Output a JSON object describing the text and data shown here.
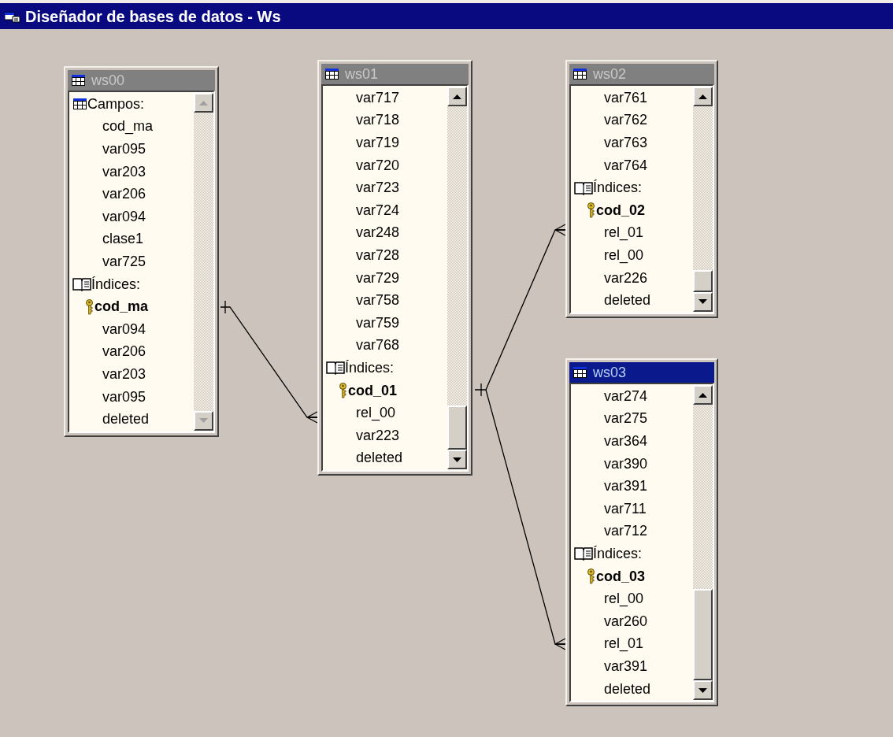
{
  "window": {
    "title": "Diseñador de bases de datos - Ws"
  },
  "tables": [
    {
      "name": "ws00",
      "active": false,
      "scrollbar_disabled": true,
      "items": [
        {
          "kind": "section",
          "text": "Campos:"
        },
        {
          "kind": "field",
          "text": "cod_ma"
        },
        {
          "kind": "field",
          "text": "var095"
        },
        {
          "kind": "field",
          "text": "var203"
        },
        {
          "kind": "field",
          "text": "var206"
        },
        {
          "kind": "field",
          "text": "var094"
        },
        {
          "kind": "field",
          "text": "clase1"
        },
        {
          "kind": "field",
          "text": "var725"
        },
        {
          "kind": "index_section",
          "text": "Índices:"
        },
        {
          "kind": "key",
          "text": "cod_ma"
        },
        {
          "kind": "field",
          "text": "var094"
        },
        {
          "kind": "field",
          "text": "var206"
        },
        {
          "kind": "field",
          "text": "var203"
        },
        {
          "kind": "field",
          "text": "var095"
        },
        {
          "kind": "field",
          "text": "deleted"
        }
      ]
    },
    {
      "name": "ws01",
      "active": false,
      "scrollbar_disabled": false,
      "items": [
        {
          "kind": "field",
          "text": "var717"
        },
        {
          "kind": "field",
          "text": "var718"
        },
        {
          "kind": "field",
          "text": "var719"
        },
        {
          "kind": "field",
          "text": "var720"
        },
        {
          "kind": "field",
          "text": "var723"
        },
        {
          "kind": "field",
          "text": "var724"
        },
        {
          "kind": "field",
          "text": "var248"
        },
        {
          "kind": "field",
          "text": "var728"
        },
        {
          "kind": "field",
          "text": "var729"
        },
        {
          "kind": "field",
          "text": "var758"
        },
        {
          "kind": "field",
          "text": "var759"
        },
        {
          "kind": "field",
          "text": "var768"
        },
        {
          "kind": "index_section",
          "text": "Índices:"
        },
        {
          "kind": "key",
          "text": "cod_01"
        },
        {
          "kind": "field",
          "text": "rel_00"
        },
        {
          "kind": "field",
          "text": "var223"
        },
        {
          "kind": "field",
          "text": "deleted"
        }
      ]
    },
    {
      "name": "ws02",
      "active": false,
      "scrollbar_disabled": false,
      "items": [
        {
          "kind": "field",
          "text": "var761"
        },
        {
          "kind": "field",
          "text": "var762"
        },
        {
          "kind": "field",
          "text": "var763"
        },
        {
          "kind": "field",
          "text": "var764"
        },
        {
          "kind": "index_section",
          "text": "Índices:"
        },
        {
          "kind": "key",
          "text": "cod_02"
        },
        {
          "kind": "field",
          "text": "rel_01"
        },
        {
          "kind": "field",
          "text": "rel_00"
        },
        {
          "kind": "field",
          "text": "var226"
        },
        {
          "kind": "field",
          "text": "deleted"
        }
      ]
    },
    {
      "name": "ws03",
      "active": true,
      "scrollbar_disabled": false,
      "items": [
        {
          "kind": "field",
          "text": "var274"
        },
        {
          "kind": "field",
          "text": "var275"
        },
        {
          "kind": "field",
          "text": "var364"
        },
        {
          "kind": "field",
          "text": "var390"
        },
        {
          "kind": "field",
          "text": "var391"
        },
        {
          "kind": "field",
          "text": "var711"
        },
        {
          "kind": "field",
          "text": "var712"
        },
        {
          "kind": "index_section",
          "text": "Índices:"
        },
        {
          "kind": "key",
          "text": "cod_03"
        },
        {
          "kind": "field",
          "text": "rel_00"
        },
        {
          "kind": "field",
          "text": "var260"
        },
        {
          "kind": "field",
          "text": "rel_01"
        },
        {
          "kind": "field",
          "text": "var391"
        },
        {
          "kind": "field",
          "text": "deleted"
        }
      ]
    }
  ]
}
